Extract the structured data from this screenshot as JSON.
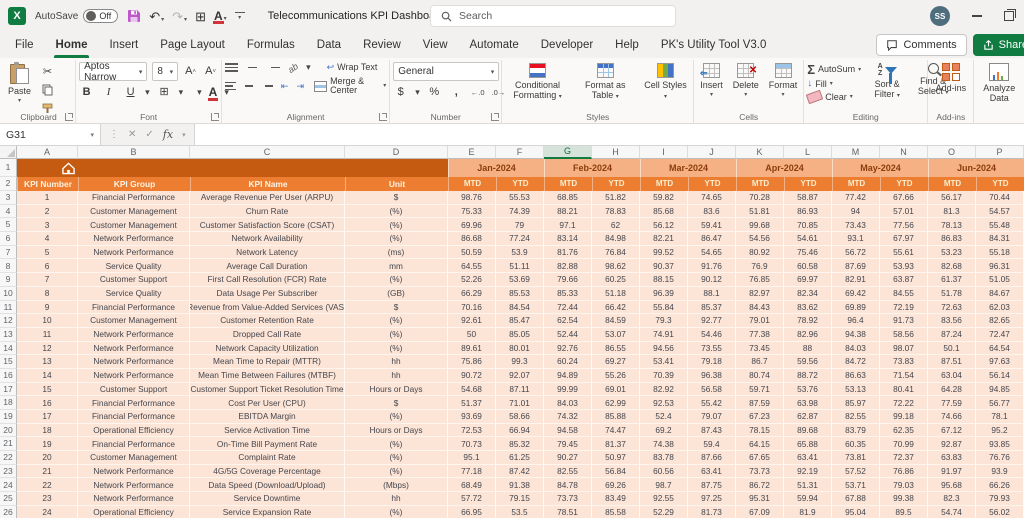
{
  "title_bar": {
    "autosave_label": "AutoSave",
    "autosave_state": "Off",
    "document_title": "Telecommunications KPI Dashboard - C...",
    "search_placeholder": "Search",
    "avatar_initials": "SS"
  },
  "icons": {
    "chevron": "▾",
    "excel_logo": "X",
    "cut": "✂",
    "borders_window": "⊞",
    "font_color_letter": "A",
    "undo": "↶",
    "redo": "↷",
    "grow_font": "A",
    "shrink_font": "A",
    "bold": "B",
    "italic": "I",
    "underline": "U",
    "autosum_glyph": "Σ",
    "dollar": "$",
    "percent": "%",
    "comma": ",",
    "inc_decimal": "←.0",
    "dec_decimal": ".0→",
    "orientation": "ab",
    "wrap_arrow": "↩",
    "fill_down_arrow": "↓",
    "fx": "fx",
    "cancel": "✕",
    "enter": "✓",
    "dots": "⋮"
  },
  "ribbon_tabs": [
    "File",
    "Home",
    "Insert",
    "Page Layout",
    "Formulas",
    "Data",
    "Review",
    "View",
    "Automate",
    "Developer",
    "Help",
    "PK's Utility Tool V3.0"
  ],
  "active_tab": "Home",
  "tab_right": {
    "comments": "Comments",
    "share": "Share"
  },
  "ribbon": {
    "paste": "Paste",
    "clipboard_group": "Clipboard",
    "font_name": "Aptos Narrow",
    "font_size": "8",
    "font_group": "Font",
    "wrap_text": "Wrap Text",
    "merge_center": "Merge & Center",
    "alignment_group": "Alignment",
    "number_format": "General",
    "number_group": "Number",
    "conditional_formatting": "Conditional Formatting",
    "format_as_table": "Format as Table",
    "cell_styles": "Cell Styles",
    "styles_group": "Styles",
    "insert": "Insert",
    "delete": "Delete",
    "format": "Format",
    "cells_group": "Cells",
    "autosum": "AutoSum",
    "fill": "Fill",
    "clear": "Clear",
    "sort_filter": "Sort & Filter",
    "find_select": "Find & Select",
    "editing_group": "Editing",
    "addins": "Add-ins",
    "addins_group": "Add-ins",
    "analyze_data": "Analyze Data"
  },
  "formula_bar": {
    "name_box": "G31",
    "formula": ""
  },
  "grid": {
    "selected_column": "G",
    "columns": [
      "A",
      "B",
      "C",
      "D",
      "E",
      "F",
      "G",
      "H",
      "I",
      "J",
      "K",
      "L",
      "M",
      "N",
      "O",
      "P"
    ],
    "months": [
      "Jan-2024",
      "Feb-2024",
      "Mar-2024",
      "Apr-2024",
      "May-2024",
      "Jun-2024"
    ],
    "sub_headers": [
      "MTD",
      "YTD"
    ],
    "header_labels": [
      "KPI Number",
      "KPI Group",
      "KPI Name",
      "Unit"
    ],
    "rows": [
      {
        "kpi_number": "1",
        "kpi_group": "Financial Performance",
        "kpi_name": "Average Revenue Per User (ARPU)",
        "unit": "$",
        "values": [
          "98.76",
          "55.53",
          "68.85",
          "51.82",
          "59.82",
          "74.65",
          "70.28",
          "58.87",
          "77.42",
          "67.66",
          "56.17",
          "70.44"
        ]
      },
      {
        "kpi_number": "2",
        "kpi_group": "Customer Management",
        "kpi_name": "Churn Rate",
        "unit": "(%)",
        "values": [
          "75.33",
          "74.39",
          "88.21",
          "78.83",
          "85.68",
          "83.6",
          "51.81",
          "86.93",
          "94",
          "57.01",
          "81.3",
          "54.57"
        ]
      },
      {
        "kpi_number": "3",
        "kpi_group": "Customer Management",
        "kpi_name": "Customer Satisfaction Score (CSAT)",
        "unit": "(%)",
        "values": [
          "69.96",
          "79",
          "97.1",
          "62",
          "56.12",
          "59.41",
          "99.68",
          "70.85",
          "73.43",
          "77.56",
          "78.13",
          "55.48"
        ]
      },
      {
        "kpi_number": "4",
        "kpi_group": "Network Performance",
        "kpi_name": "Network Availability",
        "unit": "(%)",
        "values": [
          "86.68",
          "77.24",
          "83.14",
          "84.98",
          "82.21",
          "86.47",
          "54.56",
          "54.61",
          "93.1",
          "67.97",
          "86.83",
          "84.31"
        ]
      },
      {
        "kpi_number": "5",
        "kpi_group": "Network Performance",
        "kpi_name": "Network Latency",
        "unit": "(ms)",
        "values": [
          "50.59",
          "53.9",
          "81.76",
          "76.84",
          "99.52",
          "54.65",
          "80.92",
          "75.46",
          "56.72",
          "55.61",
          "53.23",
          "55.18"
        ]
      },
      {
        "kpi_number": "6",
        "kpi_group": "Service Quality",
        "kpi_name": "Average Call Duration",
        "unit": "mm",
        "values": [
          "64.55",
          "51.11",
          "82.88",
          "98.62",
          "90.37",
          "91.76",
          "76.9",
          "60.58",
          "87.69",
          "53.93",
          "82.68",
          "96.31"
        ]
      },
      {
        "kpi_number": "7",
        "kpi_group": "Customer Support",
        "kpi_name": "First Call Resolution (FCR) Rate",
        "unit": "(%)",
        "values": [
          "52.26",
          "53.69",
          "79.66",
          "60.25",
          "88.15",
          "90.12",
          "76.85",
          "69.97",
          "82.91",
          "63.87",
          "61.37",
          "51.05"
        ]
      },
      {
        "kpi_number": "8",
        "kpi_group": "Service Quality",
        "kpi_name": "Data Usage Per Subscriber",
        "unit": "(GB)",
        "values": [
          "66.29",
          "85.53",
          "85.33",
          "51.18",
          "96.39",
          "88.1",
          "82.97",
          "82.34",
          "69.42",
          "84.55",
          "51.78",
          "84.67"
        ]
      },
      {
        "kpi_number": "9",
        "kpi_group": "Financial Performance",
        "kpi_name": "Revenue from Value-Added Services (VAS)",
        "unit": "$",
        "values": [
          "70.16",
          "84.54",
          "72.44",
          "66.42",
          "55.84",
          "85.37",
          "84.43",
          "83.62",
          "69.89",
          "72.19",
          "72.63",
          "62.03"
        ]
      },
      {
        "kpi_number": "10",
        "kpi_group": "Customer Management",
        "kpi_name": "Customer Retention Rate",
        "unit": "(%)",
        "values": [
          "92.61",
          "85.47",
          "62.54",
          "84.59",
          "79.3",
          "92.77",
          "79.01",
          "78.92",
          "96.4",
          "91.73",
          "83.56",
          "82.65"
        ]
      },
      {
        "kpi_number": "11",
        "kpi_group": "Network Performance",
        "kpi_name": "Dropped Call Rate",
        "unit": "(%)",
        "values": [
          "50",
          "85.05",
          "52.44",
          "53.07",
          "74.91",
          "54.46",
          "77.38",
          "82.96",
          "94.38",
          "58.56",
          "87.24",
          "72.47"
        ]
      },
      {
        "kpi_number": "12",
        "kpi_group": "Network Performance",
        "kpi_name": "Network Capacity Utilization",
        "unit": "(%)",
        "values": [
          "89.61",
          "80.01",
          "92.76",
          "86.55",
          "94.56",
          "73.55",
          "73.45",
          "88",
          "84.03",
          "98.07",
          "50.1",
          "64.54"
        ]
      },
      {
        "kpi_number": "13",
        "kpi_group": "Network Performance",
        "kpi_name": "Mean Time to Repair (MTTR)",
        "unit": "hh",
        "values": [
          "75.86",
          "99.3",
          "60.24",
          "69.27",
          "53.41",
          "79.18",
          "86.7",
          "59.56",
          "84.72",
          "73.83",
          "87.51",
          "97.63"
        ]
      },
      {
        "kpi_number": "14",
        "kpi_group": "Network Performance",
        "kpi_name": "Mean Time Between Failures (MTBF)",
        "unit": "hh",
        "values": [
          "90.72",
          "92.07",
          "94.89",
          "55.26",
          "70.39",
          "96.38",
          "80.74",
          "88.72",
          "86.63",
          "71.54",
          "63.04",
          "56.14"
        ]
      },
      {
        "kpi_number": "15",
        "kpi_group": "Customer Support",
        "kpi_name": "Customer Support Ticket Resolution Time",
        "unit": "Hours or Days",
        "values": [
          "54.68",
          "87.11",
          "99.99",
          "69.01",
          "82.92",
          "56.58",
          "59.71",
          "53.76",
          "53.13",
          "80.41",
          "64.28",
          "94.85"
        ]
      },
      {
        "kpi_number": "16",
        "kpi_group": "Financial Performance",
        "kpi_name": "Cost Per User (CPU)",
        "unit": "$",
        "values": [
          "51.37",
          "71.01",
          "84.03",
          "62.99",
          "92.53",
          "55.42",
          "87.59",
          "63.98",
          "85.97",
          "72.22",
          "77.59",
          "56.77"
        ]
      },
      {
        "kpi_number": "17",
        "kpi_group": "Financial Performance",
        "kpi_name": "EBITDA Margin",
        "unit": "(%)",
        "values": [
          "93.69",
          "58.66",
          "74.32",
          "85.88",
          "52.4",
          "79.07",
          "67.23",
          "62.87",
          "82.55",
          "99.18",
          "74.66",
          "78.1"
        ]
      },
      {
        "kpi_number": "18",
        "kpi_group": "Operational Efficiency",
        "kpi_name": "Service Activation Time",
        "unit": "Hours or Days",
        "values": [
          "72.53",
          "66.94",
          "94.58",
          "74.47",
          "69.2",
          "87.43",
          "78.15",
          "89.68",
          "83.79",
          "62.35",
          "67.12",
          "95.2"
        ]
      },
      {
        "kpi_number": "19",
        "kpi_group": "Financial Performance",
        "kpi_name": "On-Time Bill Payment Rate",
        "unit": "(%)",
        "values": [
          "70.73",
          "85.32",
          "79.45",
          "81.37",
          "74.38",
          "59.4",
          "64.15",
          "65.88",
          "60.35",
          "70.99",
          "92.87",
          "93.85"
        ]
      },
      {
        "kpi_number": "20",
        "kpi_group": "Customer Management",
        "kpi_name": "Complaint Rate",
        "unit": "(%)",
        "values": [
          "95.1",
          "61.25",
          "90.27",
          "50.97",
          "83.78",
          "87.66",
          "67.65",
          "63.41",
          "73.81",
          "72.37",
          "63.83",
          "76.76"
        ]
      },
      {
        "kpi_number": "21",
        "kpi_group": "Network Performance",
        "kpi_name": "4G/5G Coverage Percentage",
        "unit": "(%)",
        "values": [
          "77.18",
          "87.42",
          "82.55",
          "56.84",
          "60.56",
          "63.41",
          "73.73",
          "92.19",
          "57.52",
          "76.86",
          "91.97",
          "93.9"
        ]
      },
      {
        "kpi_number": "22",
        "kpi_group": "Network Performance",
        "kpi_name": "Data Speed (Download/Upload)",
        "unit": "(Mbps)",
        "values": [
          "68.49",
          "91.38",
          "84.78",
          "69.26",
          "98.7",
          "87.75",
          "86.72",
          "51.31",
          "53.71",
          "79.03",
          "95.68",
          "66.26"
        ]
      },
      {
        "kpi_number": "23",
        "kpi_group": "Network Performance",
        "kpi_name": "Service Downtime",
        "unit": "hh",
        "values": [
          "57.72",
          "79.15",
          "73.73",
          "83.49",
          "92.55",
          "97.25",
          "95.31",
          "59.94",
          "67.88",
          "99.38",
          "82.3",
          "79.93"
        ]
      },
      {
        "kpi_number": "24",
        "kpi_group": "Operational Efficiency",
        "kpi_name": "Service Expansion Rate",
        "unit": "(%)",
        "values": [
          "66.95",
          "53.5",
          "78.51",
          "85.58",
          "52.29",
          "81.73",
          "67.09",
          "81.9",
          "95.04",
          "89.5",
          "54.74",
          "56.02"
        ]
      }
    ]
  },
  "colors": {
    "header_dark_orange": "#C55A11",
    "header_orange": "#ED7D31",
    "month_peach": "#F5B183",
    "data_peach": "#FCE4D6",
    "excel_green": "#107C41"
  }
}
